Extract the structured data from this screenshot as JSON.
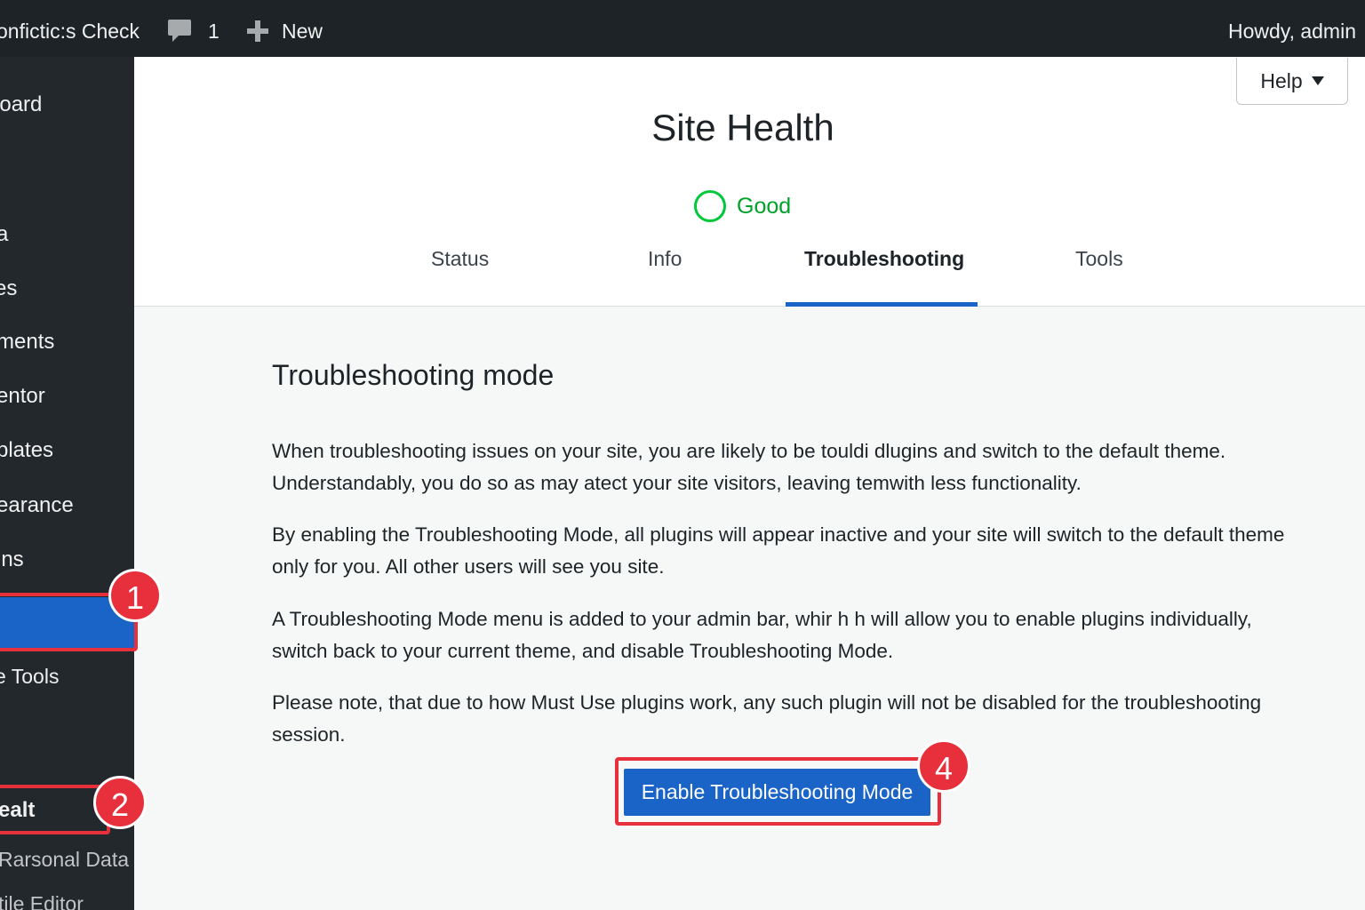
{
  "adminbar": {
    "site_name": "onfictic:s Check",
    "comments_count": "1",
    "new_label": "New",
    "howdy": "Howdy, admin"
  },
  "sidebar": {
    "items": [
      {
        "label": "board"
      },
      {
        "label": ")"
      },
      {
        "label": "a"
      },
      {
        "label": "es"
      },
      {
        "label": "ments"
      },
      {
        "label": "entor"
      },
      {
        "label": "plates"
      },
      {
        "label": "earance"
      },
      {
        "label": "ins"
      },
      {
        "label": ""
      },
      {
        "label": "e Tools"
      }
    ],
    "sub_items": [
      {
        "label": "ealt"
      },
      {
        "label": "Rarsonal Data"
      },
      {
        "label": "tile Editor"
      }
    ]
  },
  "annotations": {
    "badge_1": "1",
    "badge_2": "2",
    "badge_4": "4",
    "highlight_color": "#e8303d"
  },
  "header": {
    "help_label": "Help",
    "title": "Site Health",
    "status_label": "Good",
    "status_color": "#00a32a",
    "tabs": [
      {
        "label": "Status"
      },
      {
        "label": "Info"
      },
      {
        "label": "Troubleshooting",
        "active": true
      },
      {
        "label": "Tools"
      }
    ]
  },
  "main": {
    "section_title": "Troubleshooting mode",
    "paragraphs": [
      "When troubleshooting issues on your site, you are likely to be touldi dlugins and switch to the default theme. Understandably, you do so as may atect your site visitors, leaving temwith less functionality.",
      "By enabling the Troubleshooting Mode, all plugins will appear inactive and your site will switch to the default theme only for you. All other users will see you site.",
      "A Troubleshooting Mode menu is added to your admin bar, whir h h will allow you to enable plugins individually, switch back to your current theme, and disable Troubleshooting Mode.",
      "Please note, that due to how Must Use plugins work, any such plugin will not be disabled for the troubleshooting session."
    ],
    "enable_button": "Enable Troubleshooting Mode"
  },
  "colors": {
    "adminbar_bg": "#1d2327",
    "sidebar_bg": "#23282d",
    "accent": "#1a63c7"
  }
}
